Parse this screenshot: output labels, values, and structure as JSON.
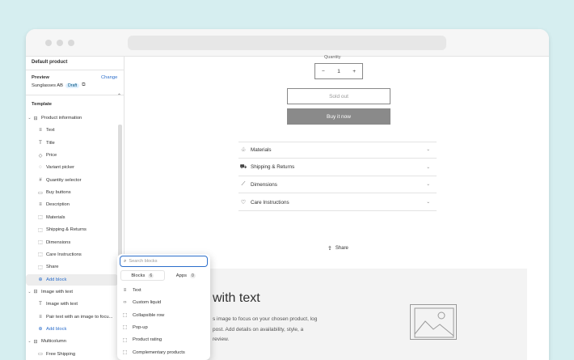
{
  "sidebar": {
    "header_title": "Default product",
    "preview_label": "Preview",
    "change_link": "Change",
    "preview_product": "Sunglasses AB",
    "preview_badge": "Draft",
    "template_label": "Template",
    "items": [
      {
        "label": "Product information",
        "icon": "layout-section-icon",
        "glyph": "⊟",
        "level": 1,
        "chevron": "⌄"
      },
      {
        "label": "Text",
        "icon": "text-block-icon",
        "glyph": "≡",
        "level": 2
      },
      {
        "label": "Title",
        "icon": "title-icon",
        "glyph": "T",
        "level": 2
      },
      {
        "label": "Price",
        "icon": "price-tag-icon",
        "glyph": "◇",
        "level": 2
      },
      {
        "label": "Variant picker",
        "icon": "variant-picker-icon",
        "glyph": "◌",
        "level": 2
      },
      {
        "label": "Quantity selector",
        "icon": "hashtag-icon",
        "glyph": "#",
        "level": 2
      },
      {
        "label": "Buy buttons",
        "icon": "buy-button-icon",
        "glyph": "▭",
        "level": 2
      },
      {
        "label": "Description",
        "icon": "description-icon",
        "glyph": "≡",
        "level": 2
      },
      {
        "label": "Materials",
        "icon": "collapsible-row-icon",
        "glyph": "⬚",
        "level": 2
      },
      {
        "label": "Shipping & Returns",
        "icon": "collapsible-row-icon",
        "glyph": "⬚",
        "level": 2
      },
      {
        "label": "Dimensions",
        "icon": "collapsible-row-icon",
        "glyph": "⬚",
        "level": 2
      },
      {
        "label": "Care Instructions",
        "icon": "collapsible-row-icon",
        "glyph": "⬚",
        "level": 2
      },
      {
        "label": "Share",
        "icon": "share-icon",
        "glyph": "⬚",
        "level": 2
      },
      {
        "label": "Add block",
        "icon": "add-circle-icon",
        "glyph": "⊕",
        "level": 2,
        "add": true,
        "active": true
      },
      {
        "label": "Image with text",
        "icon": "image-with-text-section-icon",
        "glyph": "⊟",
        "level": 1,
        "chevron": "⌄"
      },
      {
        "label": "Image with text",
        "icon": "title-icon",
        "glyph": "T",
        "level": 2
      },
      {
        "label": "Pair text with an image to focu...",
        "icon": "text-block-icon",
        "glyph": "≡",
        "level": 2
      },
      {
        "label": "Add block",
        "icon": "add-circle-icon",
        "glyph": "⊕",
        "level": 2,
        "add": true
      },
      {
        "label": "Multicolumn",
        "icon": "multicolumn-section-icon",
        "glyph": "⊟",
        "level": 1,
        "chevron": "⌄"
      },
      {
        "label": "Free Shipping",
        "icon": "column-block-icon",
        "glyph": "▭",
        "level": 2
      }
    ]
  },
  "preview": {
    "quantity_label": "Quantity",
    "quantity_value": "1",
    "minus": "−",
    "plus": "+",
    "sold_out": "Sold out",
    "buy_now": "Buy it now",
    "accordions": [
      {
        "label": "Materials",
        "icon": "materials-icon",
        "glyph": "♧"
      },
      {
        "label": "Shipping & Returns",
        "icon": "truck-icon",
        "glyph": "⛟"
      },
      {
        "label": "Dimensions",
        "icon": "ruler-icon",
        "glyph": "⟋"
      },
      {
        "label": "Care Instructions",
        "icon": "heart-icon",
        "glyph": "♡"
      }
    ],
    "share": "Share",
    "iwt_title": "with text",
    "iwt_body": "s image to focus on your chosen product, log post. Add details on availability, style, a review."
  },
  "popover": {
    "search_placeholder": "Search blocks",
    "tabs": [
      {
        "label": "Blocks",
        "count": "6",
        "active": true
      },
      {
        "label": "Apps",
        "count": "0",
        "active": false
      }
    ],
    "items": [
      {
        "label": "Text",
        "icon": "text-block-icon",
        "glyph": "≡"
      },
      {
        "label": "Custom liquid",
        "icon": "code-icon",
        "glyph": "‹›"
      },
      {
        "label": "Collapsible row",
        "icon": "collapsible-row-icon",
        "glyph": "⬚"
      },
      {
        "label": "Pop-up",
        "icon": "popup-icon",
        "glyph": "⬚"
      },
      {
        "label": "Product rating",
        "icon": "rating-icon",
        "glyph": "⬚"
      },
      {
        "label": "Complementary products",
        "icon": "complementary-icon",
        "glyph": "⬚"
      }
    ]
  }
}
